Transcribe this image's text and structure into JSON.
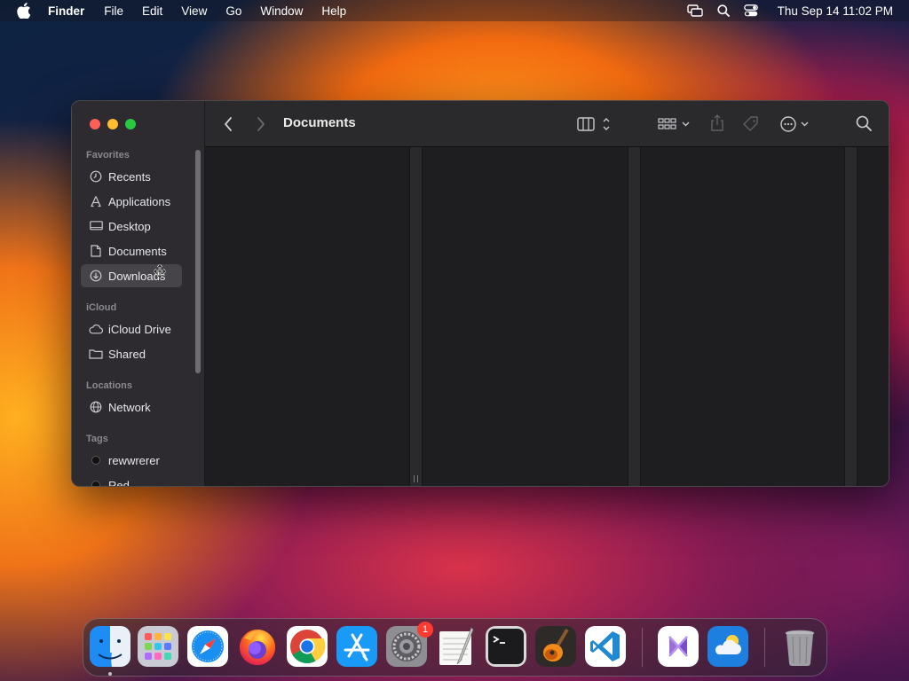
{
  "menubar": {
    "app_name": "Finder",
    "menus": [
      "File",
      "Edit",
      "View",
      "Go",
      "Window",
      "Help"
    ],
    "clock": "Thu Sep 14  11:02 PM",
    "status_icons": [
      "screen-mirroring-icon",
      "search-icon",
      "control-center-icon"
    ]
  },
  "window": {
    "title": "Documents",
    "toolbar_icons": [
      "back-icon",
      "forward-icon",
      "column-view-icon",
      "group-icon",
      "share-icon",
      "tag-icon",
      "more-actions-icon",
      "search-icon"
    ],
    "sidebar": {
      "sections": [
        {
          "title": "Favorites",
          "items": [
            {
              "label": "Recents",
              "icon": "clock-icon"
            },
            {
              "label": "Applications",
              "icon": "applications-icon"
            },
            {
              "label": "Desktop",
              "icon": "desktop-icon"
            },
            {
              "label": "Documents",
              "icon": "document-icon"
            },
            {
              "label": "Downloads",
              "icon": "download-icon",
              "selected": true
            }
          ]
        },
        {
          "title": "iCloud",
          "items": [
            {
              "label": "iCloud Drive",
              "icon": "cloud-icon"
            },
            {
              "label": "Shared",
              "icon": "shared-folder-icon"
            }
          ]
        },
        {
          "title": "Locations",
          "items": [
            {
              "label": "Network",
              "icon": "globe-icon"
            }
          ]
        },
        {
          "title": "Tags",
          "items": [
            {
              "label": "rewwrerer",
              "icon": "tag-dot"
            },
            {
              "label": "Red",
              "icon": "tag-dot"
            }
          ]
        }
      ]
    }
  },
  "dock": {
    "apps": [
      {
        "name": "Finder",
        "icon": "finder-icon",
        "running": true
      },
      {
        "name": "Launchpad",
        "icon": "launchpad-icon"
      },
      {
        "name": "Safari",
        "icon": "safari-icon"
      },
      {
        "name": "Firefox",
        "icon": "firefox-icon"
      },
      {
        "name": "Chrome",
        "icon": "chrome-icon"
      },
      {
        "name": "App Store",
        "icon": "app-store-icon"
      },
      {
        "name": "System Settings",
        "icon": "system-settings-icon",
        "badge": "1"
      },
      {
        "name": "TextEdit",
        "icon": "textedit-icon"
      },
      {
        "name": "Terminal",
        "icon": "terminal-icon"
      },
      {
        "name": "GarageBand",
        "icon": "garageband-icon"
      },
      {
        "name": "Visual Studio Code",
        "icon": "vscode-icon"
      },
      {
        "name": "Visual Studio",
        "icon": "visual-studio-icon"
      },
      {
        "name": "Weather",
        "icon": "weather-icon"
      },
      {
        "name": "Trash",
        "icon": "trash-icon"
      }
    ],
    "colors": {
      "badge": "#ff3b30"
    }
  },
  "colors": {
    "window_bg": "#232325",
    "sidebar_bg": "#2d2b2f",
    "selection": "#464449"
  }
}
